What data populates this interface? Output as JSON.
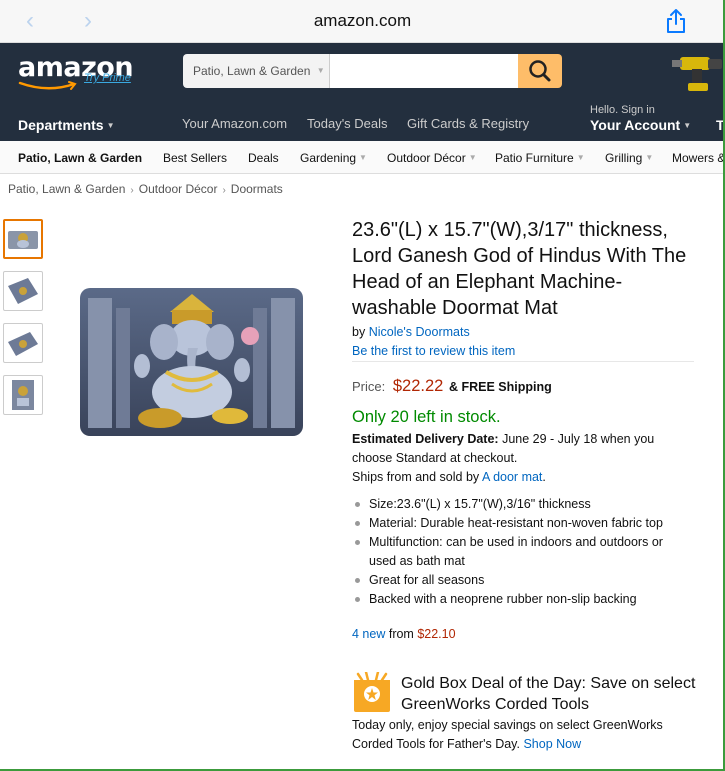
{
  "browser": {
    "url": "amazon.com",
    "back": "‹",
    "forward": "›"
  },
  "header": {
    "logo": "amazon",
    "try_prime": "Try Prime",
    "search_category": "Patio, Lawn & Garden",
    "search_value": "",
    "departments": "Departments",
    "links": [
      "Your Amazon.com",
      "Today's Deals",
      "Gift Cards & Registry"
    ],
    "hello": "Hello. Sign in",
    "account": "Your Account",
    "extra": "T"
  },
  "subnav": [
    {
      "label": "Patio, Lawn & Garden"
    },
    {
      "label": "Best Sellers"
    },
    {
      "label": "Deals"
    },
    {
      "label": "Gardening"
    },
    {
      "label": "Outdoor Décor"
    },
    {
      "label": "Patio Furniture"
    },
    {
      "label": "Grilling"
    },
    {
      "label": "Mowers &"
    }
  ],
  "breadcrumb": [
    "Patio, Lawn & Garden",
    "Outdoor Décor",
    "Doormats"
  ],
  "product": {
    "title": "23.6\"(L) x 15.7\"(W),3/17\" thickness, Lord Ganesh God of Hindus With The Head of an Elephant Machine-washable Doormat Mat",
    "by_label": "by",
    "brand": "Nicole's Doormats",
    "review_link": "Be the first to review this item",
    "price_label": "Price:",
    "price": "$22.22",
    "shipping": "& FREE Shipping",
    "stock": "Only 20 left in stock.",
    "delivery_label": "Estimated Delivery Date:",
    "delivery_text": "June 29 - July 18 when you choose Standard at checkout.",
    "ships_from": "Ships from and sold by",
    "seller": "A door mat",
    "ships_period": ".",
    "bullets": [
      "Size:23.6\"(L) x 15.7\"(W),3/16\" thickness",
      "Material: Durable heat-resistant non-woven fabric top",
      "Multifunction: can be used in indoors and outdoors or used as bath mat",
      "Great for all seasons",
      "Backed with a neoprene rubber non-slip backing"
    ],
    "offers_count": "4 new",
    "offers_from": "from",
    "offers_price": "$22.10"
  },
  "goldbox": {
    "title": "Gold Box Deal of the Day: Save on select GreenWorks Corded Tools",
    "desc": "Today only, enjoy special savings on select GreenWorks Corded Tools for Father's Day.",
    "shop_now": "Shop Now"
  },
  "colors": {
    "header_bg": "#232f3e",
    "search_button": "#febd69",
    "price": "#b12704",
    "stock": "#008a00",
    "link": "#0066c0",
    "thumb_active": "#e77600"
  }
}
